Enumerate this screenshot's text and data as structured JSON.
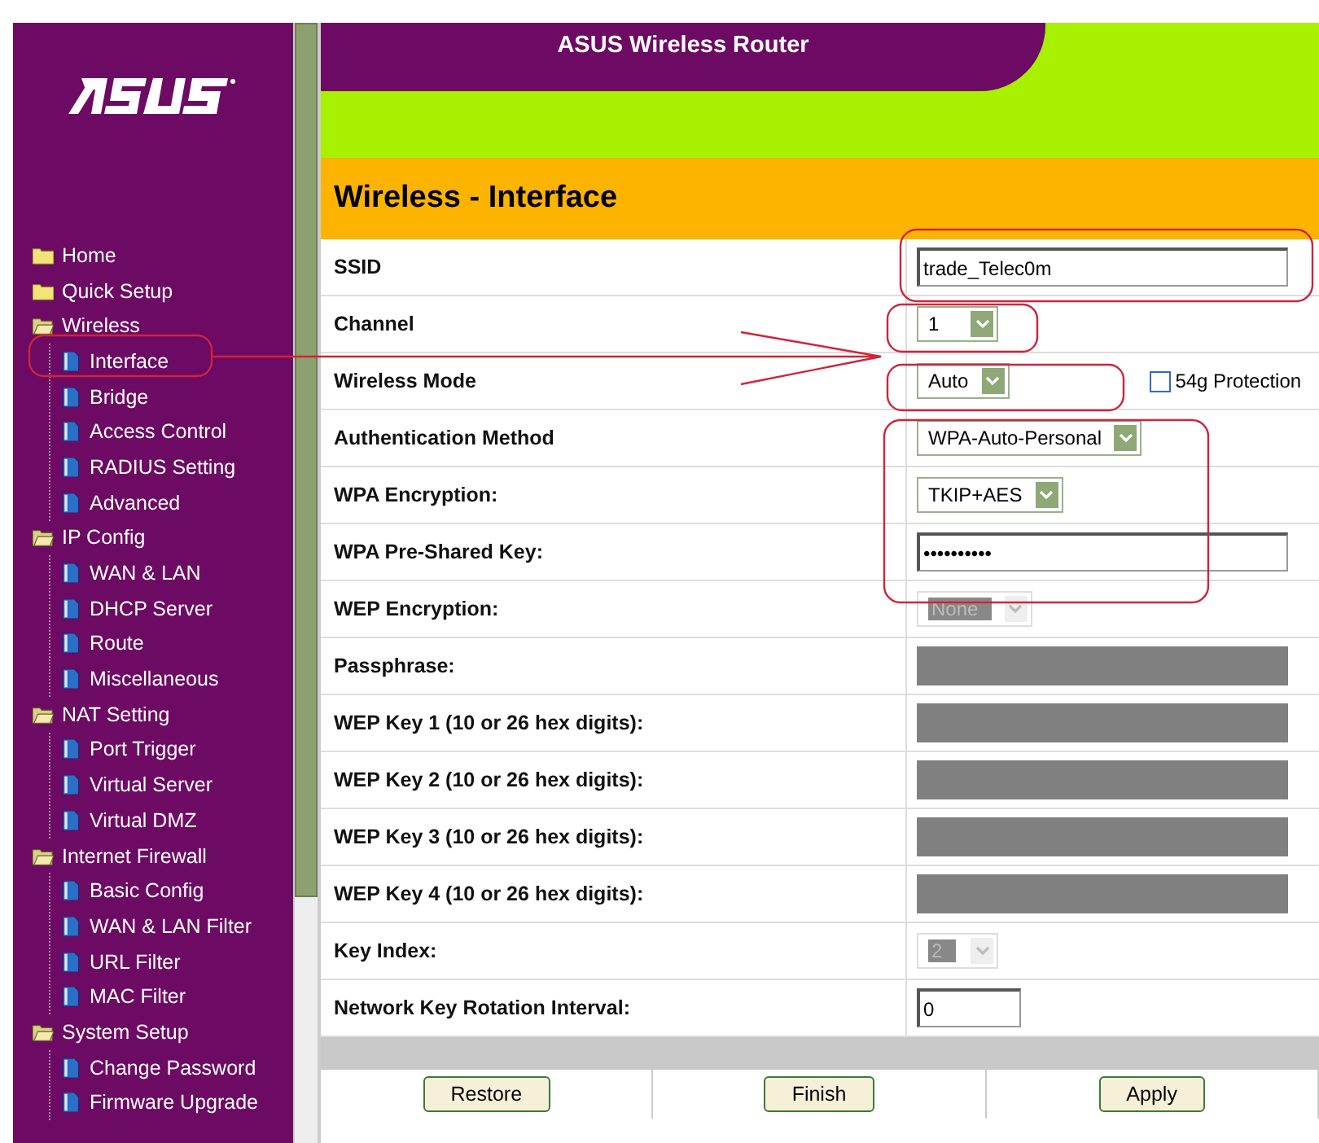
{
  "header": {
    "title": "ASUS Wireless Router"
  },
  "sidebar": {
    "items": [
      {
        "label": "Home"
      },
      {
        "label": "Quick Setup"
      },
      {
        "label": "Wireless",
        "children": [
          {
            "label": "Interface"
          },
          {
            "label": "Bridge"
          },
          {
            "label": "Access Control"
          },
          {
            "label": "RADIUS Setting"
          },
          {
            "label": "Advanced"
          }
        ]
      },
      {
        "label": "IP Config",
        "children": [
          {
            "label": "WAN & LAN"
          },
          {
            "label": "DHCP Server"
          },
          {
            "label": "Route"
          },
          {
            "label": "Miscellaneous"
          }
        ]
      },
      {
        "label": "NAT Setting",
        "children": [
          {
            "label": "Port Trigger"
          },
          {
            "label": "Virtual Server"
          },
          {
            "label": "Virtual DMZ"
          }
        ]
      },
      {
        "label": "Internet Firewall",
        "children": [
          {
            "label": "Basic Config"
          },
          {
            "label": "WAN & LAN Filter"
          },
          {
            "label": "URL Filter"
          },
          {
            "label": "MAC Filter"
          }
        ]
      },
      {
        "label": "System Setup",
        "children": [
          {
            "label": "Change Password"
          },
          {
            "label": "Firmware Upgrade"
          }
        ]
      }
    ]
  },
  "page_title": "Wireless - Interface",
  "rows": [
    {
      "label": "SSID",
      "kind": "text",
      "value": "trade_Telec0m",
      "disabled": false
    },
    {
      "label": "Channel",
      "kind": "select",
      "value": "1",
      "disabled": false
    },
    {
      "label": "Wireless Mode",
      "kind": "select",
      "value": "Auto",
      "disabled": false,
      "checkbox": {
        "label": "54g Protection",
        "checked": false
      }
    },
    {
      "label": "Authentication Method",
      "kind": "select",
      "value": "WPA-Auto-Personal",
      "disabled": false
    },
    {
      "label": "WPA Encryption:",
      "kind": "select",
      "value": "TKIP+AES",
      "disabled": false
    },
    {
      "label": "WPA Pre-Shared Key:",
      "kind": "text",
      "value": "••••••••••",
      "disabled": false
    },
    {
      "label": "WEP Encryption:",
      "kind": "select",
      "value": "None",
      "disabled": true
    },
    {
      "label": "Passphrase:",
      "kind": "text",
      "disabled": true
    },
    {
      "label": "WEP Key 1 (10 or 26 hex digits):",
      "kind": "text",
      "disabled": true
    },
    {
      "label": "WEP Key 2 (10 or 26 hex digits):",
      "kind": "text",
      "disabled": true
    },
    {
      "label": "WEP Key 3 (10 or 26 hex digits):",
      "kind": "text",
      "disabled": true
    },
    {
      "label": "WEP Key 4 (10 or 26 hex digits):",
      "kind": "text",
      "disabled": true
    },
    {
      "label": "Key Index:",
      "kind": "select",
      "value": "2",
      "disabled": true
    },
    {
      "label": "Network Key Rotation Interval:",
      "kind": "number",
      "value": "0",
      "disabled": false
    }
  ],
  "buttons": [
    "Restore",
    "Finish",
    "Apply"
  ]
}
